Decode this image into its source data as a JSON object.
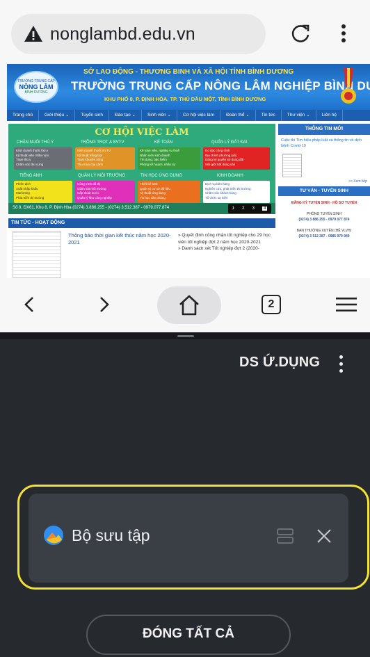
{
  "browser": {
    "url": "nonglambd.edu.vn",
    "tab_count": "2"
  },
  "site": {
    "logo": {
      "top": "TRƯỜNG TRUNG CẤP",
      "main": "NÔNG LÂM",
      "bottom": "BÌNH DƯƠNG"
    },
    "department": "SỞ LAO ĐỘNG - THƯƠNG BINH VÀ XÃ HỘI TỈNH BÌNH DƯƠNG",
    "title": "TRƯỜNG TRUNG CẤP NÔNG LÂM NGHIỆP BÌNH DƯƠNG",
    "address": "KHU PHỐ 8, P. ĐỊNH HÒA, TP. THỦ DẦU MỘT, TỈNH BÌNH DƯƠNG",
    "nav": [
      "Trang chủ",
      "Giới thiệu ⌄",
      "Tuyển sinh",
      "Đào tạo ⌄",
      "Sinh viên ⌄",
      "Cơ hội việc làm",
      "Đoàn thể ⌄",
      "Tin tức",
      "Thư viện ⌄",
      "Liên hệ"
    ],
    "banner": {
      "title": "CƠ HỘI VIỆC LÀM",
      "categories_top": [
        "CHĂN NUÔI THÚ Y",
        "TRỒNG TRỌT & BVTV",
        "KẾ TOÁN",
        "QUẢN LÝ ĐẤT ĐAI"
      ],
      "categories_bottom": [
        "TIẾNG ANH",
        "QUẢN LÝ MÔI TRƯỜNG",
        "TIN HỌC ỨNG DỤNG",
        "KINH DOANH"
      ],
      "boxes_top": [
        [
          "Kinh doanh thuốc thú y",
          "Kỹ thuật viên chăn nuôi",
          "Trạm thú y",
          "Chăm sóc thú cưng"
        ],
        [
          "Kinh doanh thuốc BVTV",
          "Kỹ thuật trồng trọt",
          "Trạm khuyến nông",
          "Thu mua cây cảnh"
        ],
        [
          "Kế toán viên, nghiệp vụ thuế",
          "Nhân viên kinh doanh",
          "Tín dụng, bảo hiểm",
          "Phòng kế hoạch, nhân sự"
        ],
        [
          "Đo đạc công trình",
          "Địa chính phường (xã)",
          "Đăng ký quyền sử dụng đất",
          "Môi giới bất động sản"
        ]
      ],
      "boxes_bottom": [
        [
          "Phiên dịch",
          "Xuất nhập khẩu",
          "Marketing",
          "Phát triển thị trường"
        ],
        [
          "Công trình đô thị",
          "Giám sát môi trường",
          "Cấp thoát nước",
          "Quản lý khu công nghiệp"
        ],
        [
          "Thiết kế web",
          "Quản trị cơ sở dữ liệu",
          "Kỹ thuật ứng dụng",
          "Tin học văn phòng"
        ],
        [
          "Dịch vụ bán hàng",
          "Nghiên cứu, phát triển thị trường",
          "Chăm sóc khách hàng",
          "Tổ chức sự kiện"
        ]
      ],
      "contact": "Số 8, ĐX61, Khu 8, P. Định Hòa   (0274) 3.886.255 - (0274) 3.512.387 - 0979.077.874",
      "slides": [
        "1",
        "2",
        "3",
        "4"
      ],
      "active_slide": "4"
    },
    "sidebar": {
      "news_title": "THÔNG TIN MỚI",
      "news_item": "Cuộc thi Tìm hiểu pháp luật và thông tin về dịch bệnh Covid-19",
      "more": ">> Xem tiếp",
      "consult_title": "TƯ VẤN - TUYỂN SINH",
      "register": "ĐĂNG KÝ TUYỂN SINH - HỒ SƠ TUYỂN",
      "office1": "PHÒNG TUYỂN SINH",
      "phone1": "(0274) 3 886 255 - 0979 077 874",
      "office2": "BAN THƯỜNG XUYÊN (HỆ VLVH)",
      "phone2": "(0274) 3 512 387 - 0985 979 949"
    },
    "news": {
      "heading": "TIN TỨC - HOẠT ĐỘNG",
      "main": "Thông báo thời gian kết thúc năm học 2020-2021",
      "list": [
        "Quyết định công nhận tốt nghiệp cho 29 học viên tốt nghiệp đợt 2 năm học 2020-2021",
        "Danh sách xét Tốt nghiệp đợt 2 (2020-"
      ]
    }
  },
  "overlay": {
    "apps_label": "DS Ứ.DỤNG",
    "gallery_label": "Bộ sưu tập",
    "close_all": "ĐÓNG TẤT CẢ"
  },
  "colors": {
    "highlight": "#f4e52c",
    "dark_bg": "#26292e",
    "card_bg": "#3a3e45",
    "site_blue": "#1d71cc"
  }
}
